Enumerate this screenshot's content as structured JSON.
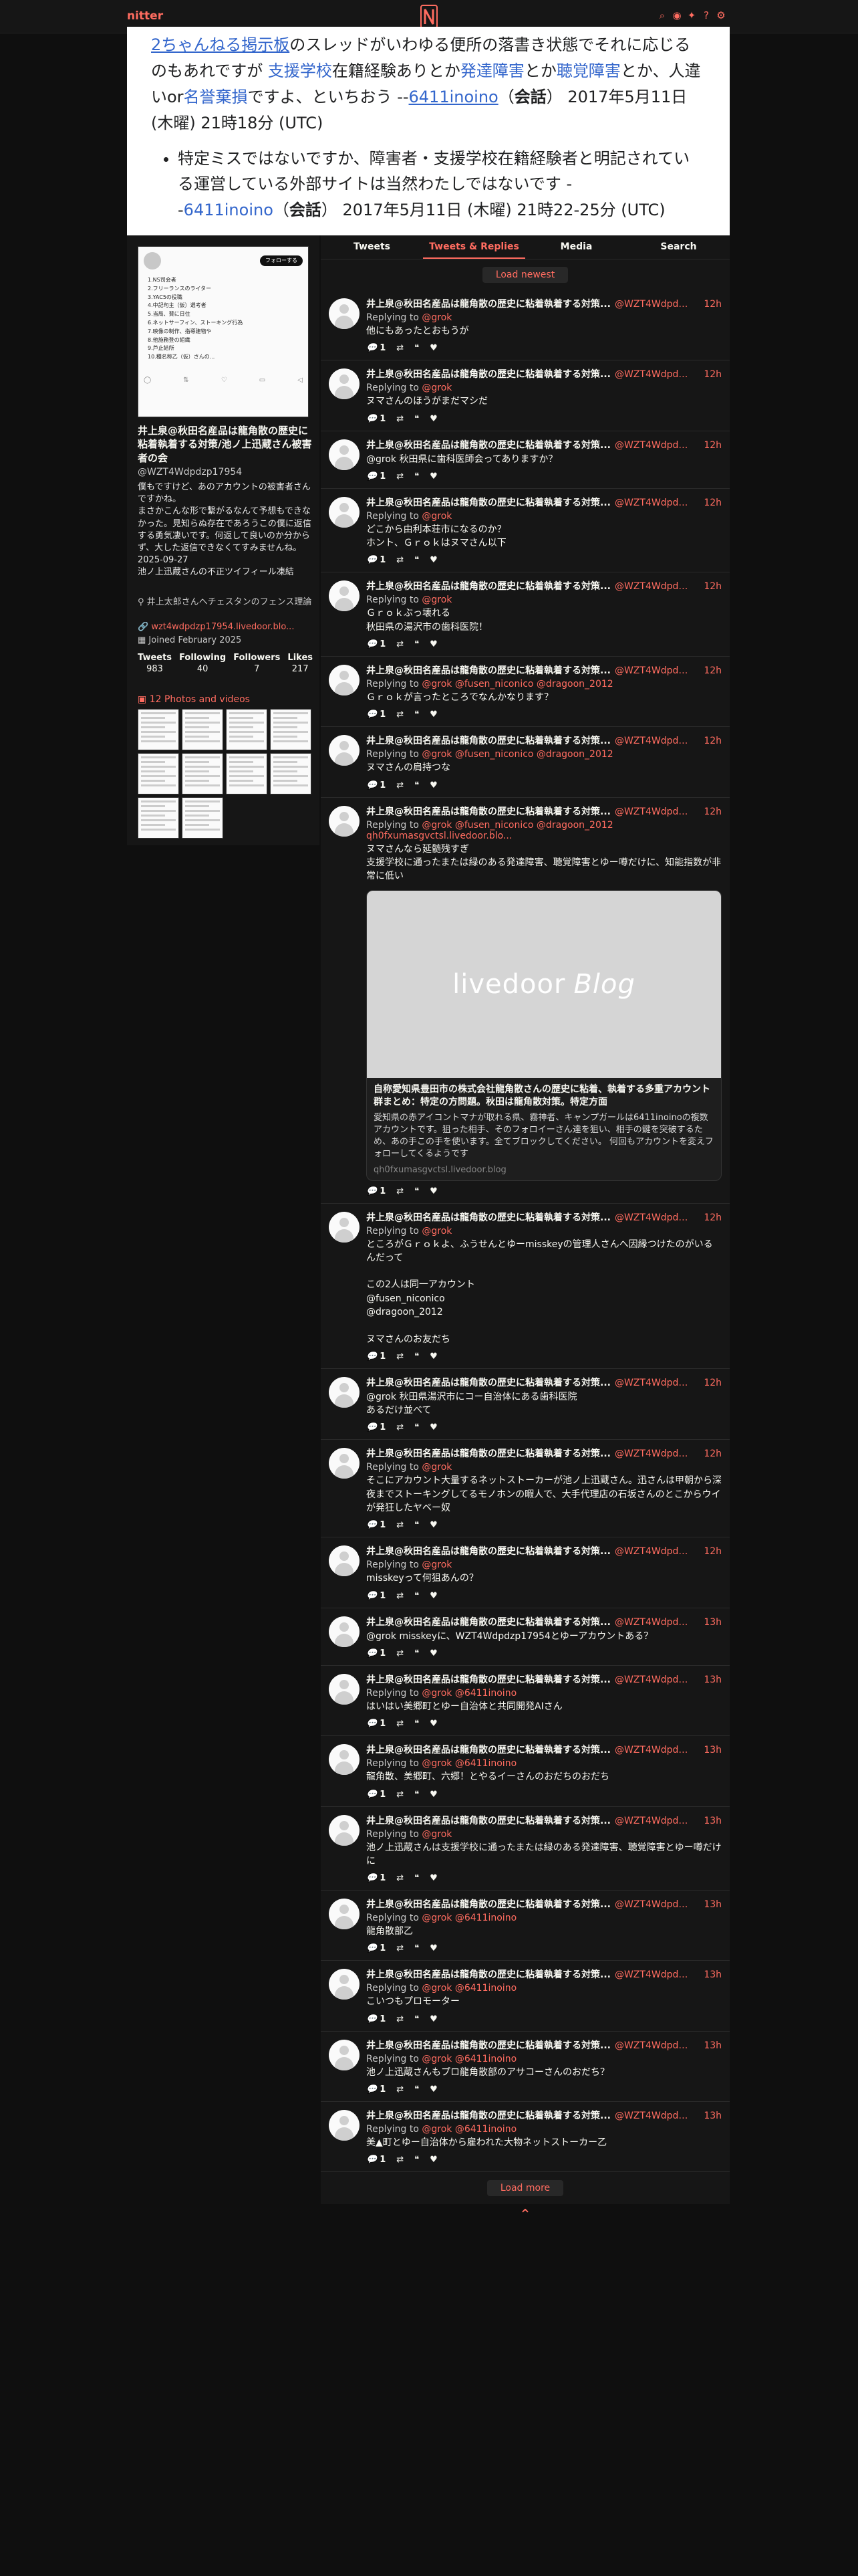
{
  "nav": {
    "brand": "nitter",
    "icons": [
      "search-icon",
      "rss-icon",
      "bird-icon",
      "info-icon",
      "settings-icon"
    ],
    "icon_glyphs": [
      "⌕",
      "◉",
      "✦",
      "?",
      "⚙"
    ]
  },
  "banner": {
    "p1_a": "2ちゃんねる掲示板",
    "p1_b": "のスレッドがいわゆる便所の落書き状態でそれに応じるのもあれですが ",
    "p1_c": "支援学校",
    "p1_d": "在籍経験ありとか",
    "p1_e": "発達障害",
    "p1_f": "とか",
    "p1_g": "聴覚障害",
    "p1_h": "とか、人違いor",
    "p1_i": "名誉棄損",
    "p1_j": "ですよ、といちおう --",
    "p1_k": "6411inoino",
    "p1_l": "（",
    "p1_m": "会話",
    "p1_n": "）",
    "p1_date": "2017年5月11日 (木曜) 21時18分 (UTC)",
    "li_a": "特定ミスではないですか、障害者・支援学校在籍経験者と明記されている運営している外部サイトは当然わたしではないです -",
    "li_b": "-",
    "li_c": "6411inoino",
    "li_d": "（",
    "li_e": "会話",
    "li_f": "）",
    "li_date": "2017年5月11日 (木曜) 21時22-25分 (UTC)"
  },
  "profile": {
    "banner_follow": "フォローする",
    "banner_list": [
      "1.NS司会者",
      "2.フリーランスのライター",
      "3.YAC5の役職",
      "4.中記句主（仮）選考者",
      "5.当局、賛に日住",
      "6.ネットサーフィン、ストーキング行為",
      "7.映像の制作、指導建物や",
      "8.他施務登の組織",
      "9.芦止結所",
      "10.種名称乙（仮）さんの..."
    ],
    "name": "井上泉@秋田名産品は龍角散の歴史に粘着執着する対策/池ノ上迅蔵さん被害者の会",
    "handle": "@WZT4Wdpdzp17954",
    "bio": "僕もですけど、あのアカウントの被害者さんですかね。\nまさかこんな形で繋がるなんて予想もできなかった。見知らぬ存在であろうこの僕に返信する勇気凄いです。何返して良いのか分からず、大した返信できなくてすみませんね。\n2025-09-27\n池ノ上迅蔵さんの不正ツイフィール凍結",
    "location": "井上太郎さんヘチェスタンのフェンス理論",
    "website": "wzt4wdpdzp17954.livedoor.blo...",
    "joined": "Joined February 2025",
    "stats": [
      {
        "label": "Tweets",
        "value": "983"
      },
      {
        "label": "Following",
        "value": "40"
      },
      {
        "label": "Followers",
        "value": "7"
      },
      {
        "label": "Likes",
        "value": "217"
      }
    ],
    "media_link": "12 Photos and videos",
    "media_count": 10
  },
  "tabs": [
    "Tweets",
    "Tweets & Replies",
    "Media",
    "Search"
  ],
  "active_tab": 1,
  "load_newest": "Load newest",
  "load_more": "Load more",
  "tweet_name": "井上泉@秋田名産品は龍角散の歴史に粘着執着する対策...",
  "tweet_user": "@WZT4Wdpdzp...",
  "replying_label": "Replying to",
  "tweets": [
    {
      "date": "12h",
      "reply": "@grok",
      "body": "他にもあったとおもうが",
      "stats": [
        "1",
        "",
        "",
        ""
      ]
    },
    {
      "date": "12h",
      "reply": "@grok",
      "body": "ヌマさんのほうがまだマシだ",
      "stats": [
        "1",
        "",
        "",
        ""
      ]
    },
    {
      "date": "12h",
      "reply": "",
      "body": "@grok 秋田県に歯科医師会ってありますか？",
      "stats": [
        "1",
        "",
        "",
        ""
      ]
    },
    {
      "date": "12h",
      "reply": "@grok",
      "body": "どこから由利本荘市になるのか？\nホント、Ｇｒｏｋはヌマさん以下",
      "stats": [
        "1",
        "",
        "",
        ""
      ]
    },
    {
      "date": "12h",
      "reply": "@grok",
      "body": "Ｇｒｏｋぶっ壊れる\n秋田県の湯沢市の歯科医院！",
      "stats": [
        "1",
        "",
        "",
        ""
      ]
    },
    {
      "date": "12h",
      "reply": "@grok @fusen_niconico @dragoon_2012",
      "body": "Ｇｒｏｋが言ったところでなんかなります？",
      "stats": [
        "1",
        "",
        "",
        ""
      ]
    },
    {
      "date": "12h",
      "reply": "@grok @fusen_niconico @dragoon_2012",
      "body": "ヌマさんの肩持つな",
      "stats": [
        "1",
        "",
        "",
        ""
      ]
    },
    {
      "date": "12h",
      "reply": "@grok @fusen_niconico @dragoon_2012",
      "link": "qh0fxumasgvctsl.livedoor.blo...",
      "body": "ヌマさんなら延髄残すぎ\n支援学校に通ったまたは緑のある発達障害、聴覚障害とゆー噂だけに、知能指数が非常に低い",
      "card": {
        "logo": "livedoor",
        "logo2": "Blog",
        "title": "自称愛知県豊田市の株式会社龍角散さんの歴史に粘着、執着する多重アカウント群まとめ：特定の方問題。秋田は龍角散対策。特定方面",
        "desc": "愛知県の赤アイコントマナが取れる県、霧神者、キャンプガールは6411inoinoの複数アカウントです。狙った相手、そのフォロイーさん達を狙い、相手の鍵を突破するため、あの手この手を使います。全てブロックしてください。 何回もアカウントを変えフォローしてくるようです",
        "domain": "qh0fxumasgvctsl.livedoor.blog"
      },
      "stats": [
        "1",
        "",
        "",
        ""
      ]
    },
    {
      "date": "12h",
      "reply": "@grok",
      "body": "ところがＧｒｏｋよ、ふうせんとゆーmisskeyの管理人さんへ因縁つけたのがいるんだって\n\nこの2人は同一アカウント\n@fusen_niconico\n@dragoon_2012\n\nヌマさんのお友だち",
      "stats": [
        "1",
        "",
        "",
        ""
      ]
    },
    {
      "date": "12h",
      "reply": "",
      "body": "@grok 秋田県湯沢市にコー自治体にある歯科医院\nあるだけ並べて",
      "stats": [
        "1",
        "",
        "",
        ""
      ]
    },
    {
      "date": "12h",
      "reply": "@grok",
      "body": "そこにアカウント大量するネットストーカーが池ノ上迅蔵さん。迅さんは甲朝から深夜までストーキングしてるモノホンの暇人で、大手代理店の石坂さんのとこからウイが発狂したヤベー奴",
      "stats": [
        "1",
        "",
        "",
        ""
      ]
    },
    {
      "date": "12h",
      "reply": "@grok",
      "body": "misskeyって何狙あんの？",
      "stats": [
        "1",
        "",
        "",
        ""
      ]
    },
    {
      "date": "13h",
      "reply": "",
      "body": "@grok misskeyに、WZT4Wdpdzp17954とゆーアカウントある？",
      "stats": [
        "1",
        "",
        "",
        ""
      ]
    },
    {
      "date": "13h",
      "reply": "@grok @6411inoino",
      "body": "はいはい美郷町とゆー自治体と共同開発AIさん",
      "stats": [
        "1",
        "",
        "",
        ""
      ]
    },
    {
      "date": "13h",
      "reply": "@grok @6411inoino",
      "body": "龍角散、美郷町、六郷！とやるイーさんのおだちのおだち",
      "stats": [
        "1",
        "",
        "",
        ""
      ]
    },
    {
      "date": "13h",
      "reply": "@grok",
      "body": "池ノ上迅蔵さんは支援学校に通ったまたは緑のある発達障害、聴覚障害とゆー噂だけに",
      "stats": [
        "1",
        "",
        "",
        ""
      ]
    },
    {
      "date": "13h",
      "reply": "@grok @6411inoino",
      "body": "龍角散部乙",
      "stats": [
        "1",
        "",
        "",
        ""
      ]
    },
    {
      "date": "13h",
      "reply": "@grok @6411inoino",
      "body": "こいつもプロモーター",
      "stats": [
        "1",
        "",
        "",
        ""
      ]
    },
    {
      "date": "13h",
      "reply": "@grok @6411inoino",
      "body": "池ノ上迅蔵さんもプロ龍角散部のアサコーさんのおだち？",
      "stats": [
        "1",
        "",
        "",
        ""
      ]
    },
    {
      "date": "13h",
      "reply": "@grok @6411inoino",
      "body": "美▲町とゆー自治体から雇われた大物ネットストーカー乙",
      "stats": [
        "1",
        "",
        "",
        ""
      ]
    }
  ],
  "colors": {
    "accent": "#ff6c60",
    "bg": "#0f0f0f",
    "panel": "#161616"
  }
}
